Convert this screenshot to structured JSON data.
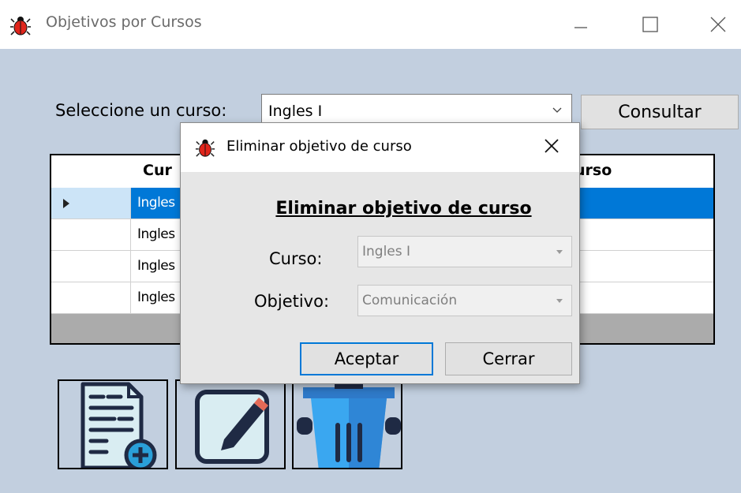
{
  "window": {
    "title": "Objetivos por Cursos",
    "controls": [
      "minimize",
      "maximize",
      "close"
    ]
  },
  "filter": {
    "label": "Seleccione un curso:",
    "selected": "Ingles I",
    "consultar_label": "Consultar"
  },
  "grid": {
    "columns": [
      "Curso",
      "Objetivo del curso"
    ],
    "visible_headers": [
      "Cur",
      "urso"
    ],
    "rows": [
      {
        "curso": "Ingles",
        "selected": true
      },
      {
        "curso": "Ingles",
        "selected": false
      },
      {
        "curso": "Ingles",
        "selected": false
      },
      {
        "curso": "Ingles",
        "selected": false
      }
    ]
  },
  "actions": [
    {
      "name": "add-document-icon"
    },
    {
      "name": "edit-icon"
    },
    {
      "name": "trash-icon"
    }
  ],
  "dialog": {
    "title": "Eliminar objetivo de curso",
    "heading": "Eliminar objetivo de curso",
    "curso_label": "Curso:",
    "curso_value": "Ingles I",
    "objetivo_label": "Objetivo:",
    "objetivo_value": "Comunicación",
    "aceptar_label": "Aceptar",
    "cerrar_label": "Cerrar"
  },
  "colors": {
    "background": "#c2cfdf",
    "selection": "#0078d7",
    "bug_icon": "#e0251b"
  }
}
